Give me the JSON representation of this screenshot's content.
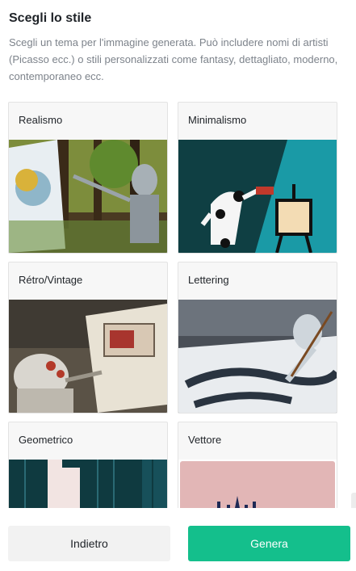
{
  "header": {
    "title": "Scegli lo stile",
    "description": "Scegli un tema per l'immagine generata. Può includere nomi di artisti (Picasso ecc.) o stili personalizzati come fantasy, dettagliato, moderno, contemporaneo ecc."
  },
  "styles": [
    {
      "label": "Realismo"
    },
    {
      "label": "Minimalismo"
    },
    {
      "label": "Rétro/Vintage"
    },
    {
      "label": "Lettering"
    },
    {
      "label": "Geometrico"
    },
    {
      "label": "Vettore"
    }
  ],
  "footer": {
    "back_label": "Indietro",
    "generate_label": "Genera"
  },
  "colors": {
    "accent": "#14bf8c"
  }
}
